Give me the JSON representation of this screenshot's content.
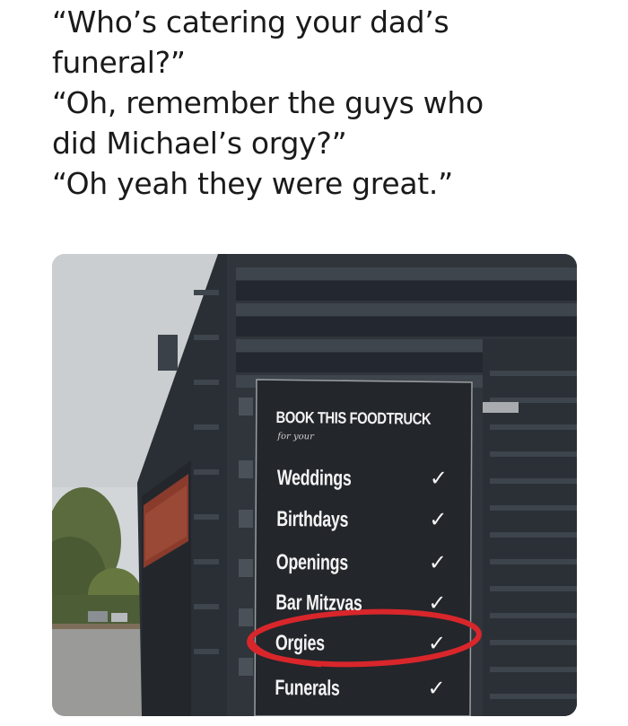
{
  "caption": {
    "lines": [
      "“Who’s catering your dad’s",
      "funeral?”",
      "“Oh, remember the guys who",
      "did Michael’s orgy?”",
      "“Oh yeah they were great.”"
    ]
  },
  "sign": {
    "title": "BOOK THIS FOODTRUCK",
    "subtitle": "for your",
    "check_glyph": "✓",
    "items": [
      {
        "label": "Weddings"
      },
      {
        "label": "Birthdays"
      },
      {
        "label": "Openings"
      },
      {
        "label": "Bar Mitzvas"
      },
      {
        "label": "Orgies",
        "circled": true
      },
      {
        "label": "Funerals"
      }
    ]
  },
  "colors": {
    "truck": "#2b3036",
    "truck_panel": "#3a4047",
    "sky": "#d3d6d8",
    "red_circle": "#d8262b",
    "sign_board": "#23262b"
  }
}
